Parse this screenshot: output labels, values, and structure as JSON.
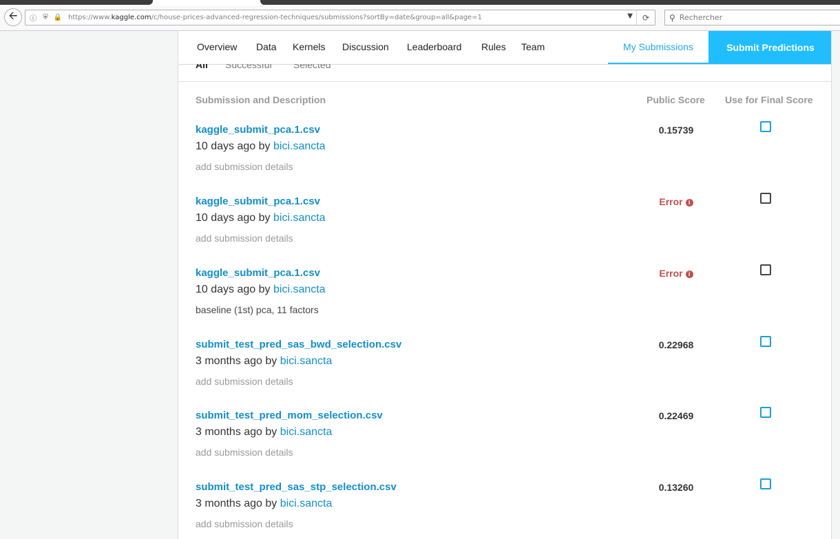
{
  "browser": {
    "url_prefix": "https://www.",
    "url_host": "kaggle.com",
    "url_path": "/c/house-prices-advanced-regression-techniques/submissions?sortBy=date&group=all&page=1",
    "search_placeholder": "Rechercher"
  },
  "nav": {
    "items": [
      "Overview",
      "Data",
      "Kernels",
      "Discussion",
      "Leaderboard",
      "Rules",
      "Team"
    ],
    "my_submissions": "My Submissions",
    "submit_predictions": "Submit Predictions"
  },
  "subtabs": [
    "All",
    "Successful",
    "Selected"
  ],
  "table": {
    "col_submission": "Submission and Description",
    "col_public_score": "Public Score",
    "col_final": "Use for Final Score",
    "rows": [
      {
        "file": "kaggle_submit_pca.1.csv",
        "when": "10 days ago by",
        "user": "bici.sancta",
        "desc": "add submission details",
        "score": "0.15739",
        "error": false
      },
      {
        "file": "kaggle_submit_pca.1.csv",
        "when": "10 days ago by",
        "user": "bici.sancta",
        "desc": "add submission details",
        "score": "Error",
        "error": true
      },
      {
        "file": "kaggle_submit_pca.1.csv",
        "when": "10 days ago by",
        "user": "bici.sancta",
        "desc": "baseline (1st) pca, 11 factors",
        "score": "Error",
        "error": true
      },
      {
        "file": "submit_test_pred_sas_bwd_selection.csv",
        "when": "3 months ago by",
        "user": "bici.sancta",
        "desc": "add submission details",
        "score": "0.22968",
        "error": false
      },
      {
        "file": "submit_test_pred_mom_selection.csv",
        "when": "3 months ago by",
        "user": "bici.sancta",
        "desc": "add submission details",
        "score": "0.22469",
        "error": false
      },
      {
        "file": "submit_test_pred_sas_stp_selection.csv",
        "when": "3 months ago by",
        "user": "bici.sancta",
        "desc": "add submission details",
        "score": "0.13260",
        "error": false
      }
    ]
  },
  "colors": {
    "accent": "#20beff",
    "link": "#138ec9",
    "error": "#c0504d"
  }
}
